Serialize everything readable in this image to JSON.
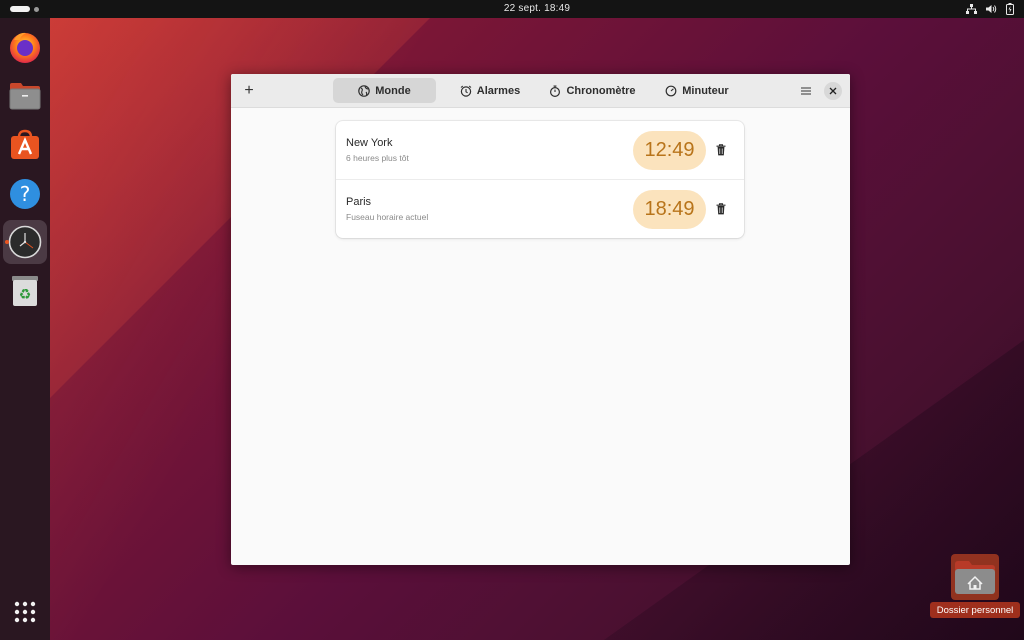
{
  "topbar": {
    "datetime": "22 sept.  18:49"
  },
  "dock": {
    "items": [
      {
        "name": "Firefox",
        "icon": "firefox-icon"
      },
      {
        "name": "Fichiers",
        "icon": "files-icon"
      },
      {
        "name": "Logiciels Ubuntu",
        "icon": "app-center-icon"
      },
      {
        "name": "Aide",
        "icon": "help-icon"
      },
      {
        "name": "Horloges",
        "icon": "clocks-icon",
        "active": true
      },
      {
        "name": "Corbeille",
        "icon": "trash-icon"
      }
    ],
    "apps_grid_icon": "show-apps-icon"
  },
  "window": {
    "add_label": "+",
    "tabs": [
      {
        "label": "Monde",
        "icon": "globe-icon",
        "selected": true
      },
      {
        "label": "Alarmes",
        "icon": "alarm-icon"
      },
      {
        "label": "Chronomètre",
        "icon": "stopwatch-icon"
      },
      {
        "label": "Minuteur",
        "icon": "timer-icon"
      }
    ],
    "clocks": [
      {
        "city": "New York",
        "offset": "6 heures plus tôt",
        "time": "12:49"
      },
      {
        "city": "Paris",
        "offset": "Fuseau horaire actuel",
        "time": "18:49"
      }
    ]
  },
  "desktop": {
    "home_folder_label": "Dossier personnel"
  },
  "colors": {
    "accent": "#e95420",
    "time_pill_bg": "#fbe3bd",
    "time_pill_text": "#b8741a"
  }
}
